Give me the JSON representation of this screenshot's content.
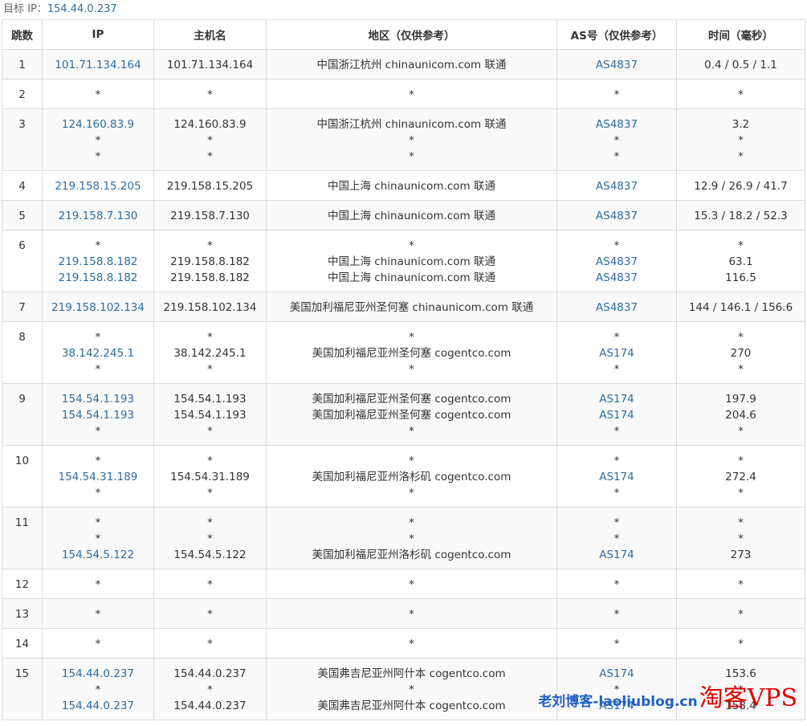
{
  "target": {
    "label": "目标 IP：",
    "ip": "154.44.0.237"
  },
  "headers": [
    "跳数",
    "IP",
    "主机名",
    "地区（仅供参考）",
    "AS号（仅供参考）",
    "时间（毫秒）"
  ],
  "rows": [
    {
      "hop": "1",
      "ip": [
        "101.71.134.164"
      ],
      "host": [
        "101.71.134.164"
      ],
      "region": [
        "中国浙江杭州 chinaunicom.com 联通"
      ],
      "as": [
        "AS4837"
      ],
      "time": [
        "0.4 / 0.5 / 1.1"
      ]
    },
    {
      "hop": "2",
      "ip": [
        "*"
      ],
      "host": [
        "*"
      ],
      "region": [
        "*"
      ],
      "as": [
        "*"
      ],
      "time": [
        "*"
      ]
    },
    {
      "hop": "3",
      "ip": [
        "124.160.83.9",
        "*",
        "*"
      ],
      "host": [
        "124.160.83.9",
        "*",
        "*"
      ],
      "region": [
        "中国浙江杭州 chinaunicom.com 联通",
        "*",
        "*"
      ],
      "as": [
        "AS4837",
        "*",
        "*"
      ],
      "time": [
        "3.2",
        "*",
        "*"
      ]
    },
    {
      "hop": "4",
      "ip": [
        "219.158.15.205"
      ],
      "host": [
        "219.158.15.205"
      ],
      "region": [
        "中国上海 chinaunicom.com 联通"
      ],
      "as": [
        "AS4837"
      ],
      "time": [
        "12.9 / 26.9 / 41.7"
      ]
    },
    {
      "hop": "5",
      "ip": [
        "219.158.7.130"
      ],
      "host": [
        "219.158.7.130"
      ],
      "region": [
        "中国上海 chinaunicom.com 联通"
      ],
      "as": [
        "AS4837"
      ],
      "time": [
        "15.3 / 18.2 / 52.3"
      ]
    },
    {
      "hop": "6",
      "ip": [
        "*",
        "219.158.8.182",
        "219.158.8.182"
      ],
      "host": [
        "*",
        "219.158.8.182",
        "219.158.8.182"
      ],
      "region": [
        "*",
        "中国上海 chinaunicom.com 联通",
        "中国上海 chinaunicom.com 联通"
      ],
      "as": [
        "*",
        "AS4837",
        "AS4837"
      ],
      "time": [
        "*",
        "63.1",
        "116.5"
      ]
    },
    {
      "hop": "7",
      "ip": [
        "219.158.102.134"
      ],
      "host": [
        "219.158.102.134"
      ],
      "region": [
        "美国加利福尼亚州圣何塞 chinaunicom.com 联通"
      ],
      "as": [
        "AS4837"
      ],
      "time": [
        "144 / 146.1 / 156.6"
      ]
    },
    {
      "hop": "8",
      "ip": [
        "*",
        "38.142.245.1",
        "*"
      ],
      "host": [
        "*",
        "38.142.245.1",
        "*"
      ],
      "region": [
        "*",
        "美国加利福尼亚州圣何塞 cogentco.com",
        "*"
      ],
      "as": [
        "*",
        "AS174",
        "*"
      ],
      "time": [
        "*",
        "270",
        "*"
      ]
    },
    {
      "hop": "9",
      "ip": [
        "154.54.1.193",
        "154.54.1.193",
        "*"
      ],
      "host": [
        "154.54.1.193",
        "154.54.1.193",
        "*"
      ],
      "region": [
        "美国加利福尼亚州圣何塞 cogentco.com",
        "美国加利福尼亚州圣何塞 cogentco.com",
        "*"
      ],
      "as": [
        "AS174",
        "AS174",
        "*"
      ],
      "time": [
        "197.9",
        "204.6",
        "*"
      ]
    },
    {
      "hop": "10",
      "ip": [
        "*",
        "154.54.31.189",
        "*"
      ],
      "host": [
        "*",
        "154.54.31.189",
        "*"
      ],
      "region": [
        "*",
        "美国加利福尼亚州洛杉矶 cogentco.com",
        "*"
      ],
      "as": [
        "*",
        "AS174",
        "*"
      ],
      "time": [
        "*",
        "272.4",
        "*"
      ]
    },
    {
      "hop": "11",
      "ip": [
        "*",
        "*",
        "154.54.5.122"
      ],
      "host": [
        "*",
        "*",
        "154.54.5.122"
      ],
      "region": [
        "*",
        "*",
        "美国加利福尼亚州洛杉矶 cogentco.com"
      ],
      "as": [
        "*",
        "*",
        "AS174"
      ],
      "time": [
        "*",
        "*",
        "273"
      ]
    },
    {
      "hop": "12",
      "ip": [
        "*"
      ],
      "host": [
        "*"
      ],
      "region": [
        "*"
      ],
      "as": [
        "*"
      ],
      "time": [
        "*"
      ]
    },
    {
      "hop": "13",
      "ip": [
        "*"
      ],
      "host": [
        "*"
      ],
      "region": [
        "*"
      ],
      "as": [
        "*"
      ],
      "time": [
        "*"
      ]
    },
    {
      "hop": "14",
      "ip": [
        "*"
      ],
      "host": [
        "*"
      ],
      "region": [
        "*"
      ],
      "as": [
        "*"
      ],
      "time": [
        "*"
      ]
    },
    {
      "hop": "15",
      "ip": [
        "154.44.0.237",
        "*",
        "154.44.0.237"
      ],
      "host": [
        "154.44.0.237",
        "*",
        "154.44.0.237"
      ],
      "region": [
        "美国弗吉尼亚州阿什本 cogentco.com",
        "*",
        "美国弗吉尼亚州阿什本 cogentco.com"
      ],
      "as": [
        "AS174",
        "*",
        "AS174"
      ],
      "time": [
        "153.6",
        "*",
        "158.4"
      ]
    }
  ],
  "watermark": {
    "site": "老刘博客-laoliublog.cn",
    "brand": "淘客VPS"
  },
  "colors": {
    "link": "#2d6ca2",
    "border": "#dcdcdc",
    "stripe": "#f9f9f9",
    "watermark_site": "#1e5fc8",
    "watermark_brand": "#e00000"
  }
}
